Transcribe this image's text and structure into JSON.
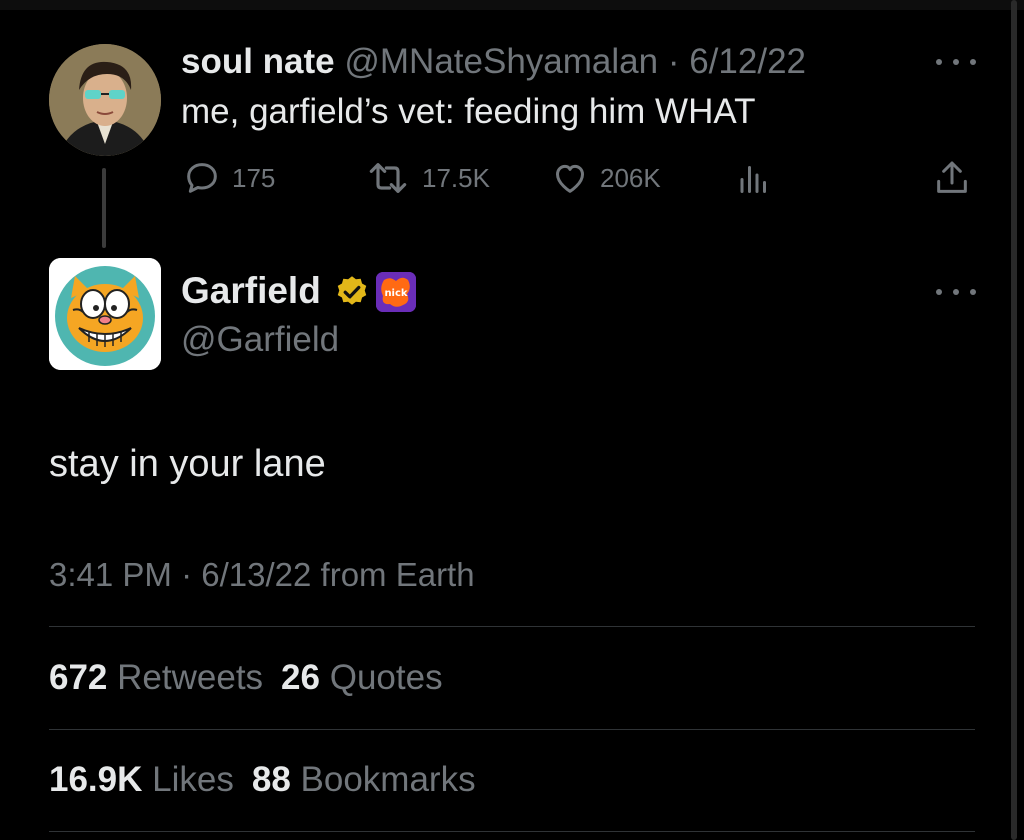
{
  "parent_tweet": {
    "display_name": "soul nate",
    "handle": "@MNateShyamalan",
    "separator": "·",
    "date": "6/12/22",
    "text": "me, garfield’s vet: feeding him WHAT",
    "replies": "175",
    "retweets": "17.5K",
    "likes": "206K",
    "avatar_icon": "user-avatar-icon",
    "more_icon": "more-options-icon"
  },
  "main_tweet": {
    "display_name": "Garfield",
    "handle": "@Garfield",
    "text": "stay in your lane",
    "time": "3:41 PM",
    "separator": "·",
    "date": "6/13/22",
    "source": "from Earth",
    "verified_badge_color": "#e2b719",
    "affiliate_badge_text": "nick",
    "affiliate_badge_color": "#6a2db8",
    "affiliate_badge_accent": "#ff6a13",
    "more_icon": "more-options-icon"
  },
  "stats": {
    "retweets_count": "672",
    "retweets_label": "Retweets",
    "quotes_count": "26",
    "quotes_label": "Quotes",
    "likes_count": "16.9K",
    "likes_label": "Likes",
    "bookmarks_count": "88",
    "bookmarks_label": "Bookmarks"
  },
  "colors": {
    "background": "#000000",
    "primary_text": "#e7e9ea",
    "secondary_text": "#71767b",
    "divider": "#2f3336"
  }
}
